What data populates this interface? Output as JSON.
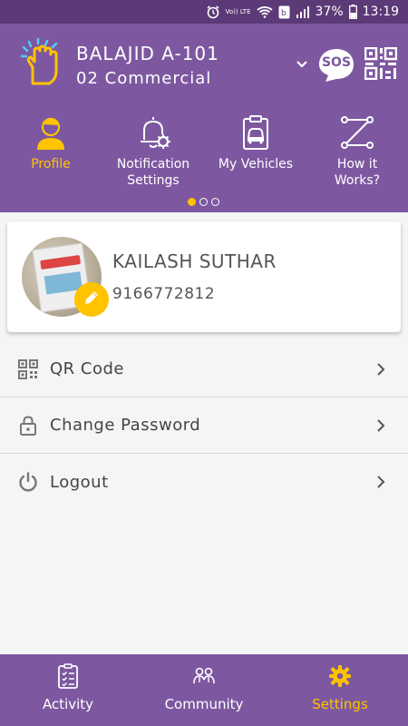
{
  "status_bar": {
    "volte": "Vo)) LTE",
    "battery": "37%",
    "time": "13:19"
  },
  "header": {
    "title": "BALAJID A-101",
    "subtitle": "02 Commercial",
    "sos_label": "SOS",
    "nav": [
      {
        "label": "Profile",
        "active": true
      },
      {
        "label": "Notification Settings",
        "active": false
      },
      {
        "label": "My Vehicles",
        "active": false
      },
      {
        "label": "How it Works?",
        "active": false
      }
    ]
  },
  "profile": {
    "name": "KAILASH SUTHAR",
    "phone": "9166772812"
  },
  "menu": [
    {
      "label": "QR Code",
      "icon": "qr-code-icon"
    },
    {
      "label": "Change Password",
      "icon": "lock-icon"
    },
    {
      "label": "Logout",
      "icon": "power-icon"
    }
  ],
  "bottom_nav": [
    {
      "label": "Activity",
      "icon": "checklist-icon",
      "active": false
    },
    {
      "label": "Community",
      "icon": "people-icon",
      "active": false
    },
    {
      "label": "Settings",
      "icon": "gear-icon",
      "active": true
    }
  ],
  "colors": {
    "primary": "#7d58a0",
    "status_bar": "#5c3a78",
    "accent": "#ffc300",
    "background": "#f5f5f5"
  }
}
